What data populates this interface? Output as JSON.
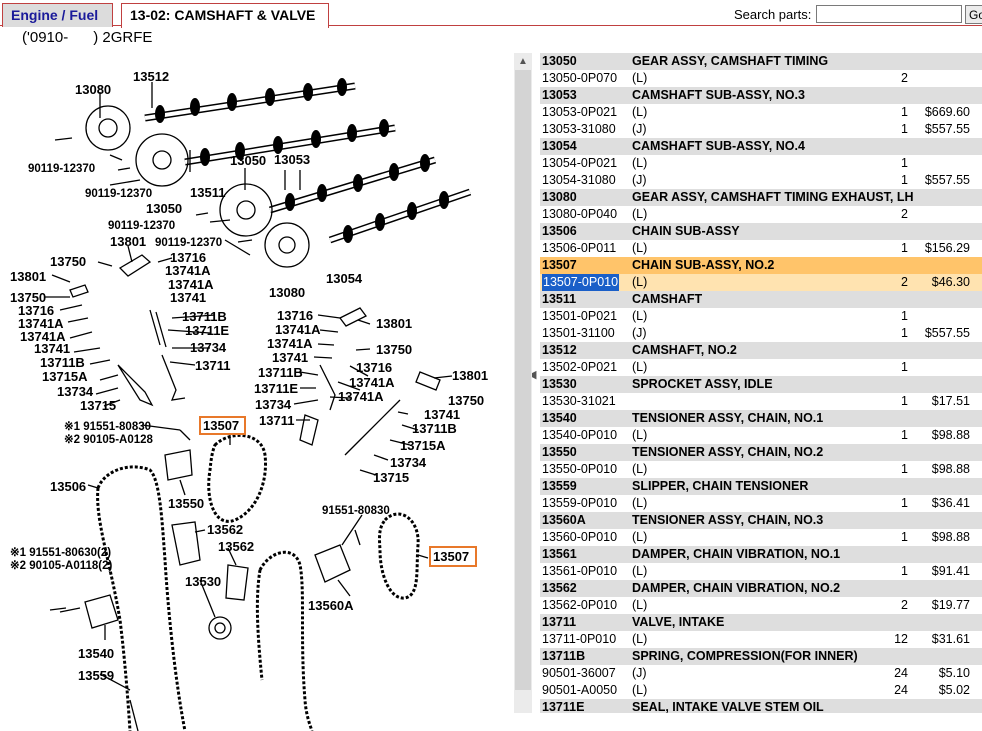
{
  "tabs": {
    "engine": "Engine / Fuel",
    "current": "13-02: CAMSHAFT & VALVE"
  },
  "search": {
    "label": "Search parts:",
    "value": "",
    "button": "Go"
  },
  "model_line": "('0910-      ) 2GRFE",
  "diagram": {
    "labels": {
      "l13512": "13512",
      "l13080a": "13080",
      "l90119a": "90119-12370",
      "l90119b": "90119-12370",
      "l13050a": "13050",
      "l13511": "13511",
      "l13050b": "13050",
      "l13053": "13053",
      "l90119c": "90119-12370",
      "l90119d": "90119-12370",
      "l13801a": "13801",
      "l13054": "13054",
      "l13080b": "13080",
      "l13750a": "13750",
      "l13716a": "13716",
      "l13741Aa": "13741A",
      "l13741Ab": "13741A",
      "l13741a": "13741",
      "l13801b": "13801",
      "l13750b": "13750",
      "l13716b": "13716",
      "l13741Ac": "13741A",
      "l13741Ad": "13741A",
      "l13741b": "13741",
      "l13711Ba": "13711B",
      "l13711Ea": "13711E",
      "l13734a": "13734",
      "l13711a": "13711",
      "l13711Bb": "13711B",
      "l13715Aa": "13715A",
      "l13734b": "13734",
      "l13715a": "13715",
      "l13716c": "13716",
      "l13741Ae": "13741A",
      "l13801c": "13801",
      "l13741Af": "13741A",
      "l13750c": "13750",
      "l13741c": "13741",
      "l13741d": "13741",
      "l13711Bc": "13711B",
      "l13711Eb": "13711E",
      "l13734c": "13734",
      "l13711b": "13711",
      "l13716d": "13716",
      "l13741Ag": "13741A",
      "l13741Ah": "13741A",
      "l13750d": "13750",
      "l13741e": "13741",
      "l13711Bd": "13711B",
      "l13715Ab": "13715A",
      "l13734d": "13734",
      "l13715b": "13715",
      "n1a": "※1 91551-80830",
      "n2a": "※2 90105-A0128",
      "l13507a": "13507",
      "l13506": "13506",
      "l13550": "13550",
      "l13562a": "13562",
      "l13562b": "13562",
      "l13530": "13530",
      "n1b": "※1 91551-80630(2)",
      "n2b": "※2 90105-A0118(2)",
      "l13540": "13540",
      "l13559": "13559",
      "l91551": "91551-80830",
      "l13560A": "13560A",
      "l13507b": "13507"
    }
  },
  "parts": [
    {
      "type": "hdr",
      "no": "13050",
      "desc": "GEAR ASSY, CAMSHAFT TIMING"
    },
    {
      "type": "part",
      "no": "13050-0P070",
      "desc": "(L)",
      "qty": "2",
      "price": ""
    },
    {
      "type": "hdr",
      "no": "13053",
      "desc": "CAMSHAFT SUB-ASSY, NO.3"
    },
    {
      "type": "part",
      "no": "13053-0P021",
      "desc": "(L)",
      "qty": "1",
      "price": "$669.60"
    },
    {
      "type": "part",
      "no": "13053-31080",
      "desc": "(J)",
      "qty": "1",
      "price": "$557.55"
    },
    {
      "type": "hdr",
      "no": "13054",
      "desc": "CAMSHAFT SUB-ASSY, NO.4"
    },
    {
      "type": "part",
      "no": "13054-0P021",
      "desc": "(L)",
      "qty": "1",
      "price": ""
    },
    {
      "type": "part",
      "no": "13054-31080",
      "desc": "(J)",
      "qty": "1",
      "price": "$557.55"
    },
    {
      "type": "hdr",
      "no": "13080",
      "desc": "GEAR ASSY, CAMSHAFT TIMING EXHAUST, LH"
    },
    {
      "type": "part",
      "no": "13080-0P040",
      "desc": "(L)",
      "qty": "2",
      "price": ""
    },
    {
      "type": "hdr",
      "no": "13506",
      "desc": "CHAIN SUB-ASSY"
    },
    {
      "type": "part",
      "no": "13506-0P011",
      "desc": "(L)",
      "qty": "1",
      "price": "$156.29"
    },
    {
      "type": "hdr",
      "no": "13507",
      "desc": "CHAIN SUB-ASSY, NO.2",
      "selected": true
    },
    {
      "type": "part",
      "no": "13507-0P010",
      "desc": "(L)",
      "qty": "2",
      "price": "$46.30",
      "selected": true
    },
    {
      "type": "hdr",
      "no": "13511",
      "desc": "CAMSHAFT"
    },
    {
      "type": "part",
      "no": "13501-0P021",
      "desc": "(L)",
      "qty": "1",
      "price": ""
    },
    {
      "type": "part",
      "no": "13501-31100",
      "desc": "(J)",
      "qty": "1",
      "price": "$557.55"
    },
    {
      "type": "hdr",
      "no": "13512",
      "desc": "CAMSHAFT, NO.2"
    },
    {
      "type": "part",
      "no": "13502-0P021",
      "desc": "(L)",
      "qty": "1",
      "price": ""
    },
    {
      "type": "hdr",
      "no": "13530",
      "desc": "SPROCKET ASSY, IDLE"
    },
    {
      "type": "part",
      "no": "13530-31021",
      "desc": "",
      "qty": "1",
      "price": "$17.51"
    },
    {
      "type": "hdr",
      "no": "13540",
      "desc": "TENSIONER ASSY, CHAIN, NO.1"
    },
    {
      "type": "part",
      "no": "13540-0P010",
      "desc": "(L)",
      "qty": "1",
      "price": "$98.88"
    },
    {
      "type": "hdr",
      "no": "13550",
      "desc": "TENSIONER ASSY, CHAIN, NO.2"
    },
    {
      "type": "part",
      "no": "13550-0P010",
      "desc": "(L)",
      "qty": "1",
      "price": "$98.88"
    },
    {
      "type": "hdr",
      "no": "13559",
      "desc": "SLIPPER, CHAIN TENSIONER"
    },
    {
      "type": "part",
      "no": "13559-0P010",
      "desc": "(L)",
      "qty": "1",
      "price": "$36.41"
    },
    {
      "type": "hdr",
      "no": "13560A",
      "desc": "TENSIONER ASSY, CHAIN, NO.3"
    },
    {
      "type": "part",
      "no": "13560-0P010",
      "desc": "(L)",
      "qty": "1",
      "price": "$98.88"
    },
    {
      "type": "hdr",
      "no": "13561",
      "desc": "DAMPER, CHAIN VIBRATION, NO.1"
    },
    {
      "type": "part",
      "no": "13561-0P010",
      "desc": "(L)",
      "qty": "1",
      "price": "$91.41"
    },
    {
      "type": "hdr",
      "no": "13562",
      "desc": "DAMPER, CHAIN VIBRATION, NO.2"
    },
    {
      "type": "part",
      "no": "13562-0P010",
      "desc": "(L)",
      "qty": "2",
      "price": "$19.77"
    },
    {
      "type": "hdr",
      "no": "13711",
      "desc": "VALVE, INTAKE"
    },
    {
      "type": "part",
      "no": "13711-0P010",
      "desc": "(L)",
      "qty": "12",
      "price": "$31.61"
    },
    {
      "type": "hdr",
      "no": "13711B",
      "desc": "SPRING, COMPRESSION(FOR INNER)"
    },
    {
      "type": "part",
      "no": "90501-36007",
      "desc": "(J)",
      "qty": "24",
      "price": "$5.10"
    },
    {
      "type": "part",
      "no": "90501-A0050",
      "desc": "(L)",
      "qty": "24",
      "price": "$5.02"
    },
    {
      "type": "hdr",
      "no": "13711E",
      "desc": "SEAL, INTAKE VALVE STEM OIL"
    }
  ]
}
